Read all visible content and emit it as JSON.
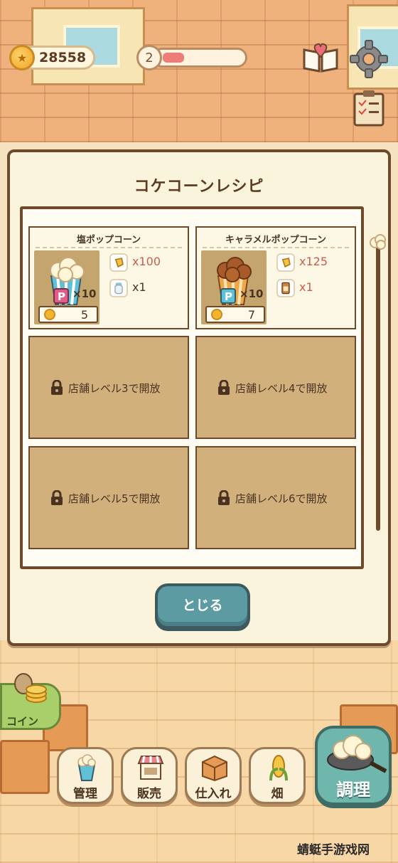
{
  "hud": {
    "coins": "28558",
    "level": "2",
    "level_progress": 0.3
  },
  "modal": {
    "title": "コケコーンレシピ",
    "close_label": "とじる"
  },
  "recipes": [
    {
      "name": "塩ポップコーン",
      "yield": "×10",
      "price": "5",
      "ingredients": [
        {
          "icon": "corn-kernel-icon",
          "qty": "x100"
        },
        {
          "icon": "salt-shaker-icon",
          "qty": "x1"
        }
      ]
    },
    {
      "name": "キャラメルポップコーン",
      "yield": "×10",
      "price": "7",
      "ingredients": [
        {
          "icon": "corn-kernel-icon",
          "qty": "x125"
        },
        {
          "icon": "caramel-jar-icon",
          "qty": "x1"
        }
      ]
    }
  ],
  "locked": [
    "店舗レベル3で開放",
    "店舗レベル4で開放",
    "店舗レベル5で開放",
    "店舗レベル6で開放"
  ],
  "nav": {
    "coin_shop": "コイン",
    "manage": "管理",
    "sell": "販売",
    "stock": "仕入れ",
    "field": "畑",
    "cook": "調理"
  },
  "watermark": "蜻蜓手游戏网",
  "colors": {
    "modal_bg": "#fbf4dc",
    "border": "#6e4a2c",
    "locked_tile": "#d2b07c",
    "close_button": "#5d9ba3",
    "cook_button": "#6fb7ac",
    "quantity_red": "#c85e4a"
  }
}
